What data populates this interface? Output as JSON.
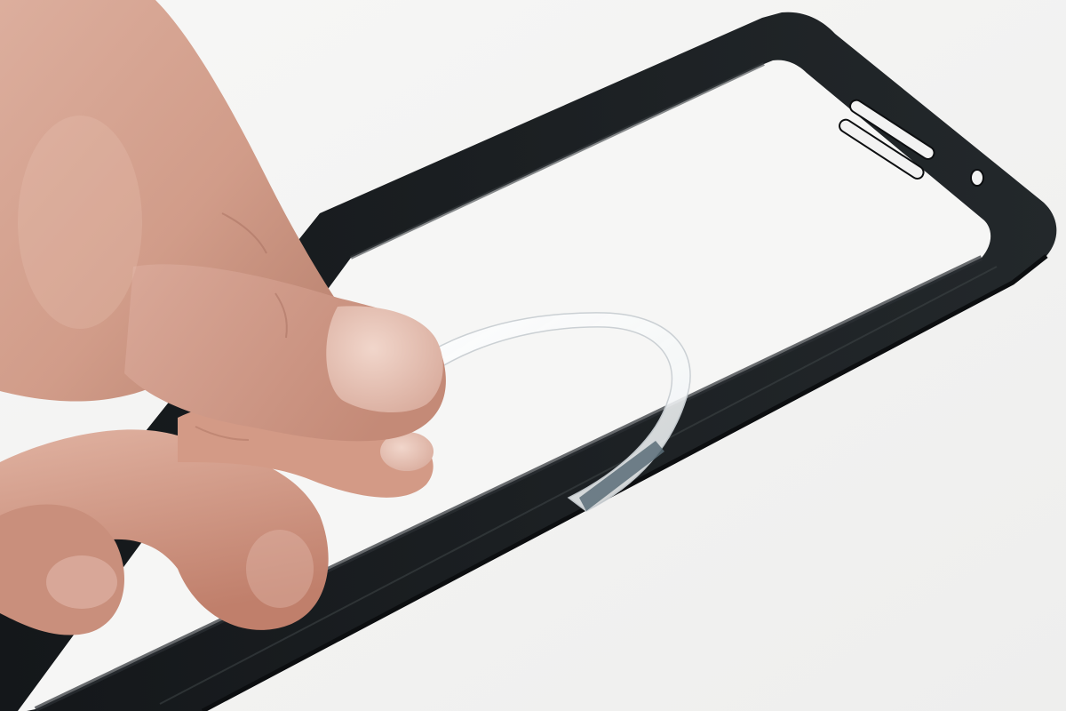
{
  "photo": {
    "subject": "hand-peeling-clear-film-inside-phone-case",
    "colors": {
      "background": "#f2f2f1",
      "case_frame": "#1f2325",
      "case_frame_edge": "#0f1113",
      "case_inner_highlight": "#3a4043",
      "skin_base": "#d6a592",
      "skin_shadow": "#b77f6c",
      "skin_highlight": "#ecc8b8",
      "nail": "#e6c2b5",
      "film": "#ffffff",
      "film_edge": "#c9cfd3",
      "film_tab": "#5b6d78"
    }
  }
}
